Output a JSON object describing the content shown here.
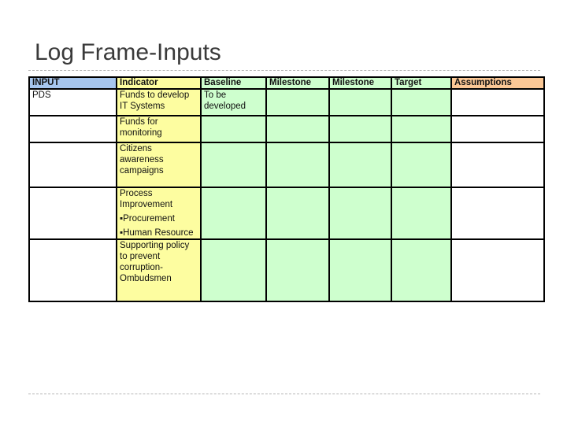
{
  "slide": {
    "title": "Log Frame-Inputs"
  },
  "table": {
    "headers": [
      "INPUT",
      "Indicator",
      "Baseline",
      "Milestone",
      "Milestone",
      "Target",
      "Assumptions"
    ],
    "header_colors": {
      "input": "#a7c6ee",
      "indicator": "#fdfda0",
      "green": "#ceffce",
      "assumptions": "#fbc896"
    },
    "rows": [
      {
        "input": "PDS",
        "indicator": "Funds to develop IT Systems",
        "indicator_bullets": [],
        "baseline": "To be developed",
        "milestone1": "",
        "milestone2": "",
        "target": "",
        "assumptions": ""
      },
      {
        "input": "",
        "indicator": "Funds for monitoring",
        "indicator_bullets": [],
        "baseline": "",
        "milestone1": "",
        "milestone2": "",
        "target": "",
        "assumptions": ""
      },
      {
        "input": "",
        "indicator": "Citizens awareness campaigns",
        "indicator_bullets": [],
        "baseline": "",
        "milestone1": "",
        "milestone2": "",
        "target": "",
        "assumptions": ""
      },
      {
        "input": "",
        "indicator": "Process Improvement",
        "indicator_bullets": [
          "▪Procurement",
          "▪Human Resource"
        ],
        "baseline": "",
        "milestone1": "",
        "milestone2": "",
        "target": "",
        "assumptions": ""
      },
      {
        "input": "",
        "indicator": "Supporting policy to prevent corruption-Ombudsmen",
        "indicator_bullets": [],
        "baseline": "",
        "milestone1": "",
        "milestone2": "",
        "target": "",
        "assumptions": ""
      }
    ]
  }
}
